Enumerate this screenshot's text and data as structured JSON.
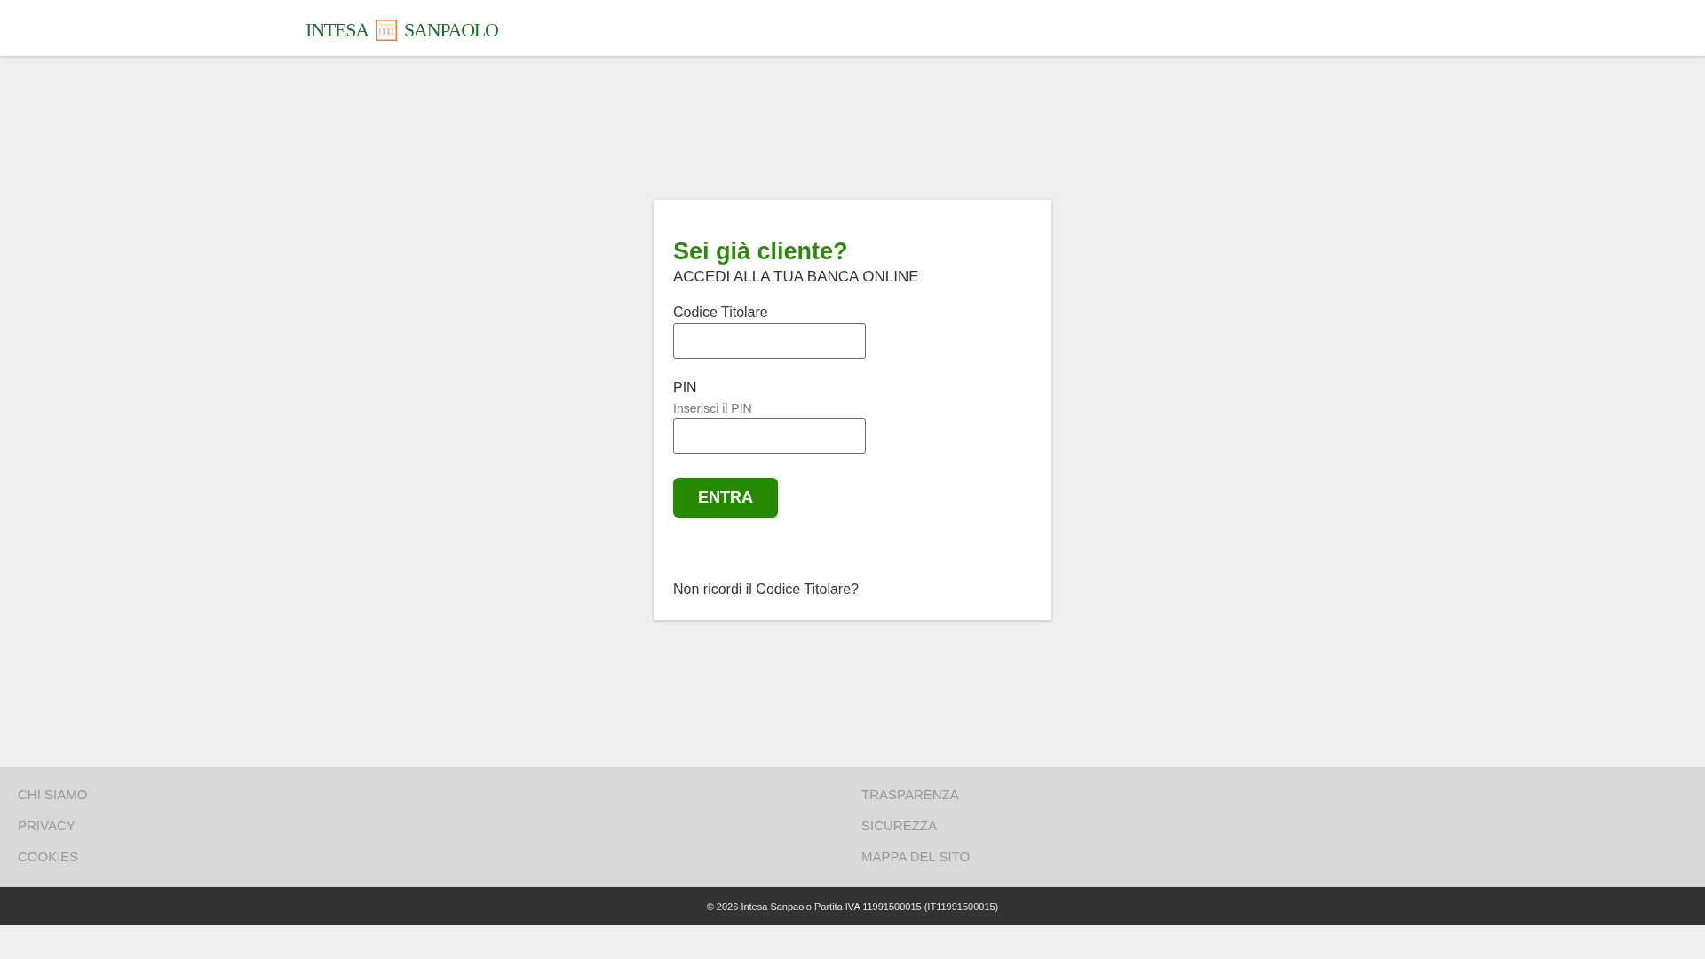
{
  "header": {
    "logo": {
      "left": "INTESA",
      "right": "SANPAOLO"
    }
  },
  "login": {
    "title": "Sei già cliente?",
    "subtitle": "ACCEDI ALLA TUA BANCA ONLINE",
    "fields": [
      {
        "label": "Codice Titolare"
      },
      {
        "label": "PIN",
        "hint": "Inserisci il PIN"
      }
    ],
    "button": "ENTRA",
    "link": "Non ricordi il Codice Titolare?"
  },
  "footer": {
    "columns": [
      {
        "links": [
          "CHI SIAMO",
          "PRIVACY",
          "COOKIES"
        ]
      },
      {
        "links": [
          "TRASPARENZA",
          "SICUREZZA",
          "MAPPA DEL SITO"
        ]
      }
    ]
  },
  "copyright": "© 2026 Intesa Sanpaolo Partita IVA 11991500015 (IT11991500015)"
}
